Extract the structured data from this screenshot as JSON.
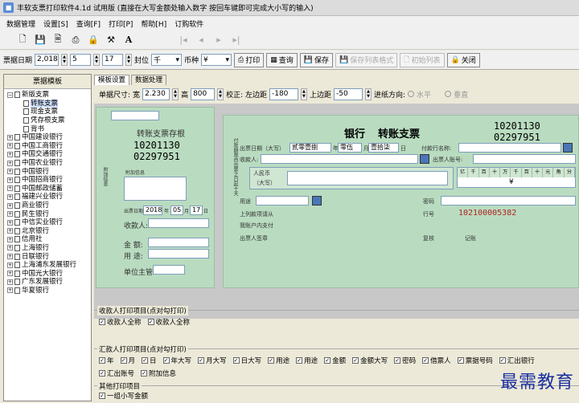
{
  "title": "丰软支票打印软件4.1d 试用版 (直接在大写金额处输入数字 按回车键即可完成大小写的输入)",
  "menu": [
    "数据管理",
    "设置[S]",
    "查询[F]",
    "打印[P]",
    "帮助[H]",
    "订购软件"
  ],
  "toolbar2": {
    "date_label": "票据日期",
    "year": "2,018",
    "month": "5",
    "day": "17",
    "position_label": "封位",
    "position_value": "千",
    "currency_label": "币种",
    "currency_value": "¥",
    "print": "打印",
    "query": "查询",
    "save": "保存",
    "save_list_format": "保存列表格式",
    "init_list": "初始列表",
    "close": "关闭"
  },
  "sidebar": {
    "header": "票据模板",
    "items": [
      {
        "label": "新版支票",
        "level": 0,
        "expanded": true
      },
      {
        "label": "转账支票",
        "level": 1
      },
      {
        "label": "现金支票",
        "level": 1
      },
      {
        "label": "凭存根支票",
        "level": 1
      },
      {
        "label": "背书",
        "level": 1
      },
      {
        "label": "中国建设银行",
        "level": 0
      },
      {
        "label": "中国工商银行",
        "level": 0
      },
      {
        "label": "中国交通银行",
        "level": 0
      },
      {
        "label": "中国农业银行",
        "level": 0
      },
      {
        "label": "中国银行",
        "level": 0
      },
      {
        "label": "中国招商银行",
        "level": 0
      },
      {
        "label": "中国邮政储蓄",
        "level": 0
      },
      {
        "label": "福建兴业银行",
        "level": 0
      },
      {
        "label": "商业银行",
        "level": 0
      },
      {
        "label": "民生银行",
        "level": 0
      },
      {
        "label": "中信实业银行",
        "level": 0
      },
      {
        "label": "北京银行",
        "level": 0
      },
      {
        "label": "信用社",
        "level": 0
      },
      {
        "label": "上海银行",
        "level": 0
      },
      {
        "label": "日联银行",
        "level": 0
      },
      {
        "label": "上海浦东发展银行",
        "level": 0
      },
      {
        "label": "中国光大银行",
        "level": 0
      },
      {
        "label": "广东发展银行",
        "level": 0
      },
      {
        "label": "华夏银行",
        "level": 0
      }
    ]
  },
  "tabs": [
    "模板设置",
    "数据处理"
  ],
  "options": {
    "size_label": "单据尺寸:",
    "width_label": "宽",
    "width_value": "2.230",
    "height_label": "高",
    "height_value": "800",
    "calib_label": "校正: 左边距",
    "left_value": "-180",
    "top_label": "上边距",
    "top_value": "-50",
    "direction_label": "进纸方向:",
    "horizontal": "水平",
    "vertical": "垂直"
  },
  "stub": {
    "title": "转账支票存根",
    "code1": "10201130",
    "code2": "02297951",
    "side_text": "附加信息",
    "date_label": "出票日期",
    "year": "2018",
    "month": "05",
    "day": "17",
    "ynd": [
      "年",
      "月",
      "日"
    ],
    "payee_label": "收款人:",
    "amount_label": "金    额:",
    "purpose_label": "用    途:",
    "unit_label": "单位主管",
    "extra_label": "附加信息"
  },
  "cheque": {
    "bank": "银行",
    "title": "转账支票",
    "code1": "10201130",
    "code2": "02297951",
    "date_label": "出票日期（大写）",
    "year": "贰零壹捌",
    "year_suffix": "年",
    "month": "零伍",
    "month_suffix": "月",
    "day": "壹拾柒",
    "day_suffix": "日",
    "payer_bank_label": "付款行名称:",
    "payee_label": "收款人:",
    "payer_account_label": "出票人账号:",
    "rmb_label": "人民币",
    "rmb_sub": "（大写）",
    "digits": [
      "亿",
      "千",
      "百",
      "十",
      "万",
      "千",
      "百",
      "十",
      "元",
      "角",
      "分"
    ],
    "currency_sign": "¥",
    "purpose_label": "用途",
    "password_label": "密码",
    "above_label": "上列款项请从",
    "row_number_label": "行号",
    "row_number": "102100005382",
    "account_label": "我账户内支付",
    "drawer_label": "出票人签章",
    "review_label": "复核",
    "record_label": "记账",
    "side_text": "付款期限自出票之日起十天"
  },
  "groups": {
    "payee": {
      "title": "收款人打印项目(点对勾打印)",
      "items": [
        "收款人全称",
        "收款人全称"
      ]
    },
    "remit": {
      "title": "汇款人打印项目(点对勾打印)",
      "items": [
        "年",
        "月",
        "日",
        "年大写",
        "月大写",
        "日大写",
        "用途",
        "用途",
        "金额",
        "金额大写",
        "密码",
        "借票人",
        "票据号码",
        "汇出银行"
      ],
      "items2": [
        "汇出账号",
        "附加信息"
      ]
    },
    "other": {
      "title": "其他打印项目",
      "items": [
        "一组小写金额"
      ]
    }
  },
  "watermark": "最需教育"
}
